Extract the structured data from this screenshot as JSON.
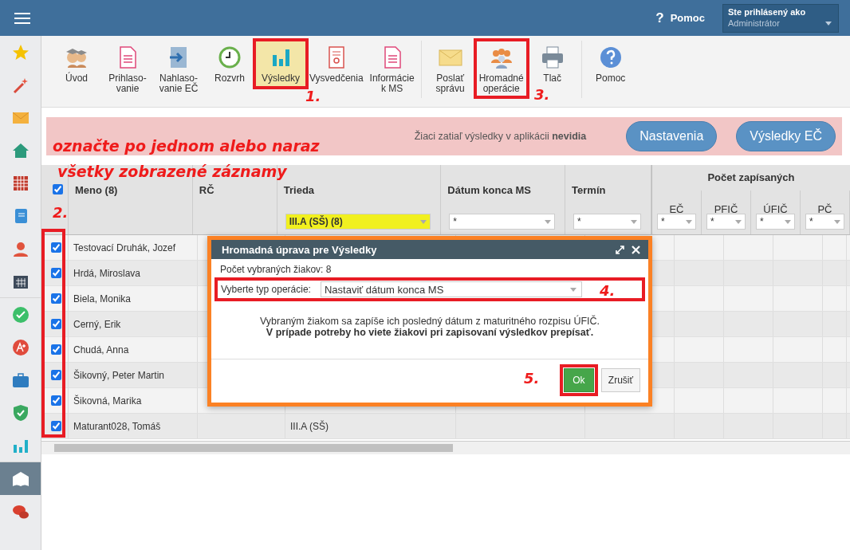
{
  "topbar": {
    "help_icon": "?",
    "help_label": "Pomoc",
    "user": {
      "label": "Ste prihlásený ako",
      "value": "Administrátor"
    }
  },
  "sidebar": {
    "groups": [
      [
        {
          "kind": "star",
          "selected": false
        },
        {
          "kind": "wand",
          "selected": false
        },
        {
          "kind": "mail",
          "selected": false
        },
        {
          "kind": "home",
          "selected": false
        },
        {
          "kind": "grid",
          "selected": false
        },
        {
          "kind": "notebook",
          "selected": false
        },
        {
          "kind": "person",
          "selected": false
        },
        {
          "kind": "calendar",
          "selected": false
        }
      ],
      [
        {
          "kind": "check",
          "selected": false
        },
        {
          "kind": "grade",
          "selected": false
        },
        {
          "kind": "briefcase",
          "selected": false
        },
        {
          "kind": "shield",
          "selected": false
        },
        {
          "kind": "chart",
          "selected": false
        }
      ],
      [
        {
          "kind": "book",
          "selected": true
        },
        {
          "kind": "chat",
          "selected": false
        }
      ]
    ]
  },
  "toolbar": {
    "groups": [
      [
        {
          "kind": "people",
          "label": "Úvod",
          "selected": false,
          "highlighted": false
        },
        {
          "kind": "doc",
          "label": "Prihlaso-\nvanie",
          "selected": false,
          "highlighted": false
        },
        {
          "kind": "arrow",
          "label": "Nahlaso-\nvanie EČ",
          "selected": false,
          "highlighted": false
        },
        {
          "kind": "clock",
          "label": "Rozvrh",
          "selected": false,
          "highlighted": false
        },
        {
          "kind": "chart",
          "label": "Výsledky",
          "selected": true,
          "highlighted": true
        },
        {
          "kind": "cert",
          "label": "Vysvedčenia",
          "selected": false,
          "highlighted": false
        },
        {
          "kind": "doc",
          "label": "Informácie\nk MS",
          "selected": false,
          "highlighted": false
        }
      ],
      [
        {
          "kind": "mail",
          "label": "Poslať\nsprávu",
          "selected": false,
          "highlighted": false
        },
        {
          "kind": "group",
          "label": "Hromadné\noperácie",
          "selected": false,
          "highlighted": true
        },
        {
          "kind": "printer",
          "label": "Tlač",
          "selected": false,
          "highlighted": false
        }
      ],
      [
        {
          "kind": "help",
          "label": "Pomoc",
          "selected": false,
          "highlighted": false
        }
      ]
    ]
  },
  "banner": {
    "message": "Žiaci zatiaľ výsledky v aplikácii **nevidia**",
    "buttons": [
      "Nastavenia",
      "Výsledky EČ"
    ]
  },
  "table": {
    "select_all_checked": true,
    "checkbox_column_highlighted": true,
    "columns": [
      {
        "label": "Meno (8)"
      },
      {
        "label": "RČ"
      },
      {
        "label": "Trieda",
        "filter": "III.A (SŠ) (8)"
      },
      {
        "label": "Dátum konca MS",
        "filter": "*"
      },
      {
        "label": "Termín",
        "filter": "*"
      }
    ],
    "group_header": "Počet zapísaných",
    "group_columns": [
      {
        "label": "EČ",
        "filter": "*"
      },
      {
        "label": "PFIČ",
        "filter": "*"
      },
      {
        "label": "ÚFIČ",
        "filter": "*"
      },
      {
        "label": "PČ",
        "filter": "*"
      }
    ],
    "rows": [
      {
        "checked": true,
        "name": "Testovací Druhák, Jozef"
      },
      {
        "checked": true,
        "name": "Hrdá, Miroslava"
      },
      {
        "checked": true,
        "name": "Biela, Monika"
      },
      {
        "checked": true,
        "name": "Cerný, Erik"
      },
      {
        "checked": true,
        "name": "Chudá, Anna"
      },
      {
        "checked": true,
        "name": "Šikovný, Peter Martin"
      },
      {
        "checked": true,
        "name": "Šikovná, Marika"
      },
      {
        "checked": true,
        "name": "Maturant028, Tomáš",
        "trieda": "III.A (SŠ)"
      }
    ]
  },
  "modal": {
    "title": "Hromadná úprava pre Výsledky",
    "count": "Počet vybraných žiakov: 8",
    "operation_label": "Vyberte typ operácie:",
    "operation_value": "Nastaviť dátum konca MS",
    "operation_highlighted": true,
    "message": "Vybraným žiakom sa zapíše ich posledný dátum z maturitného rozpisu ÚFIČ.",
    "message_bold": "V prípade potreby ho viete žiakovi pri zapisovaní výsledkov prepísať.",
    "ok": "Ok",
    "ok_highlighted": true,
    "cancel": "Zrušiť"
  },
  "annotations": [
    {
      "kind": "note",
      "text": "označte po jednom alebo naraz"
    },
    {
      "kind": "note2",
      "text": "všetky zobrazené záznamy"
    },
    {
      "kind": "n1",
      "text": "1."
    },
    {
      "kind": "n2",
      "text": "2."
    },
    {
      "kind": "n3",
      "text": "3."
    },
    {
      "kind": "n4",
      "text": "4."
    },
    {
      "kind": "n5",
      "text": "5."
    }
  ]
}
